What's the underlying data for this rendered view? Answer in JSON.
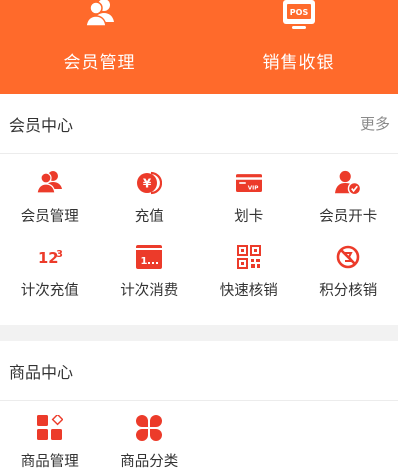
{
  "colors": {
    "accent": "#ff6a2b",
    "icon_red": "#ec3b2a"
  },
  "header": {
    "left_label": "会员管理",
    "right_label": "销售收银",
    "pos_badge": "POS"
  },
  "member_center": {
    "title": "会员中心",
    "more": "更多",
    "items": [
      {
        "label": "会员管理",
        "icon": "members-icon"
      },
      {
        "label": "充值",
        "icon": "yen-coin-icon",
        "glyph": "¥"
      },
      {
        "label": "划卡",
        "icon": "vip-card-icon",
        "glyph": "VIP"
      },
      {
        "label": "会员开卡",
        "icon": "member-open-card-icon"
      },
      {
        "label": "计次充值",
        "icon": "count-recharge-icon",
        "glyph": "123"
      },
      {
        "label": "计次消费",
        "icon": "count-consume-icon",
        "glyph": "1..."
      },
      {
        "label": "快速核销",
        "icon": "qr-scan-icon"
      },
      {
        "label": "积分核销",
        "icon": "points-cancel-icon"
      }
    ]
  },
  "goods_center": {
    "title": "商品中心",
    "items": [
      {
        "label": "商品管理",
        "icon": "goods-manage-icon"
      },
      {
        "label": "商品分类",
        "icon": "goods-category-icon"
      }
    ]
  }
}
